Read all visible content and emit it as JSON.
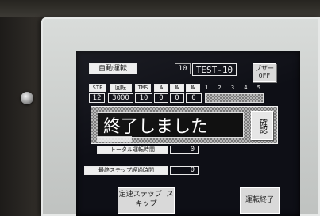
{
  "screen": {
    "mode_label": "自動運転",
    "program_no": "10",
    "program_name": "TEST-10",
    "buzzer_label": "ブザー OFF",
    "headers": [
      "STP",
      "回転",
      "TMS",
      "№",
      "№",
      "№"
    ],
    "pattern_header": "1 2 3 4 5 6",
    "row": {
      "step": "12",
      "speed": "3000",
      "time": "10",
      "v1": "0",
      "v2": "0",
      "v3": "0"
    },
    "dialog": {
      "message": "終了しました",
      "confirm_label": "確認"
    },
    "counter1": {
      "label": "トータル運転時間",
      "value": "0"
    },
    "counter2": {
      "label": "最終ステップ経過時間",
      "value": "0"
    },
    "bottom_left_button": "定速ステップ スキップ",
    "bottom_right_button": "運転終了"
  }
}
